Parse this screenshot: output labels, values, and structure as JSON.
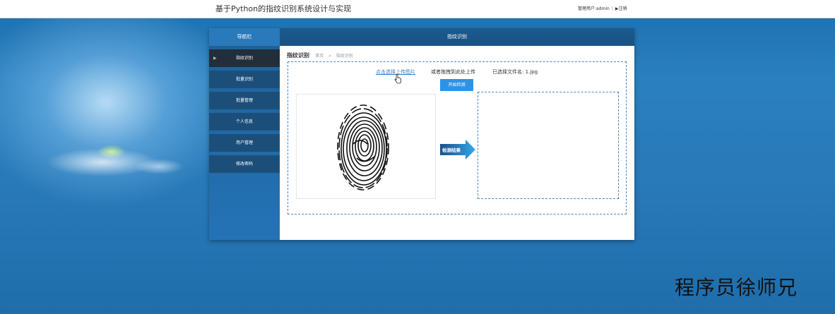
{
  "header": {
    "title": "基于Python的指纹识别系统设计与实现",
    "user_label": "管理用户:admin",
    "separator": "|",
    "logout_label": "▶注销"
  },
  "sidebar": {
    "title": "导航栏",
    "items": [
      {
        "label": "指纹识别",
        "active": true
      },
      {
        "label": "批量识别",
        "active": false
      },
      {
        "label": "批量管理",
        "active": false
      },
      {
        "label": "个人信息",
        "active": false
      },
      {
        "label": "用户管理",
        "active": false
      },
      {
        "label": "修改密码",
        "active": false
      }
    ]
  },
  "main": {
    "header_title": "指纹识别",
    "page_title": "指纹识别",
    "breadcrumb": [
      "首页",
      "指纹识别"
    ],
    "breadcrumb_sep": ">",
    "upload_link": "点击选择上传图片",
    "drag_hint": "或者拖拽到此处上传",
    "selected_file": "已选择文件名: 1.jpg",
    "detect_button": "开始检测",
    "result_arrow_label": "检测结果"
  },
  "watermark": "程序员徐师兄",
  "colors": {
    "accent": "#2f93e5",
    "sidebar_bg": "#1b4f7a",
    "sidebar_active": "#222e3a",
    "header_bg": "#1b5a8e",
    "link": "#3d7fc0"
  }
}
